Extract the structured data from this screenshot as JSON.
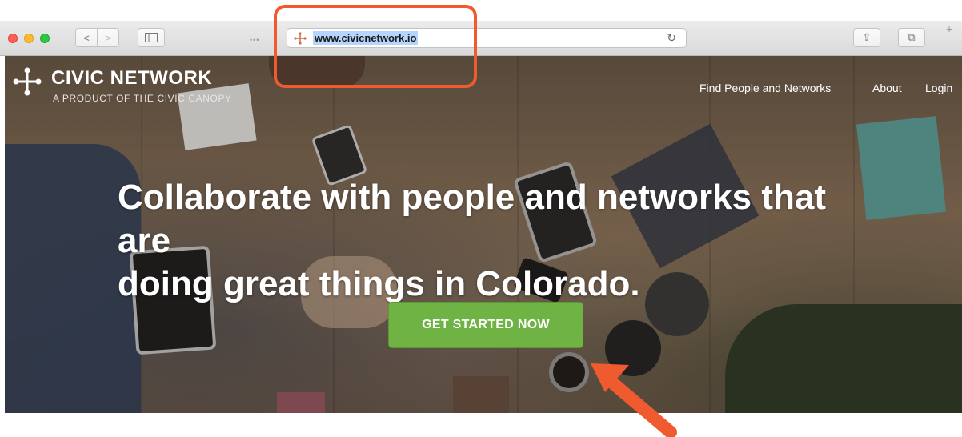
{
  "browser": {
    "url": "www.civicnetwork.io",
    "back_glyph": "<",
    "forward_glyph": ">",
    "overflow_glyph": "•••",
    "reload_glyph": "↻",
    "share_glyph": "⇪",
    "tabs_glyph": "⧉",
    "newtab_glyph": "+"
  },
  "site": {
    "brand_title": "CIVIC NETWORK",
    "brand_subtitle": "A PRODUCT OF THE CIVIC CANOPY",
    "nav": {
      "find": "Find People and Networks",
      "about": "About",
      "login": "Login"
    },
    "headline_line1": "Collaborate with people and networks that are",
    "headline_line2": "doing great things in Colorado.",
    "cta_label": "GET STARTED NOW"
  },
  "colors": {
    "annotation": "#ef5b2e",
    "cta": "#6fb344",
    "traffic_red": "#fc5f57",
    "traffic_yellow": "#fdbc2e",
    "traffic_green": "#2ac940"
  },
  "icons": {
    "logo": "civic-network-logo-icon",
    "favicon": "civic-network-favicon-icon",
    "arrow": "annotation-arrow-icon"
  }
}
